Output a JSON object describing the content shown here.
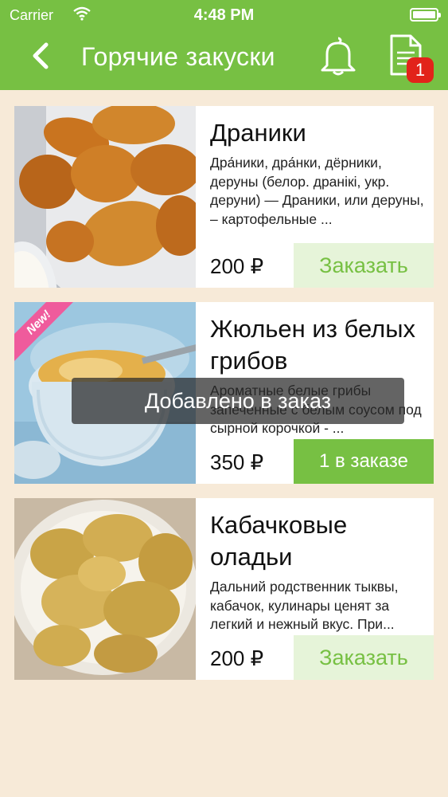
{
  "status_bar": {
    "carrier": "Carrier",
    "time": "4:48 PM"
  },
  "nav": {
    "title": "Горячие закуски",
    "cart_count": "1"
  },
  "items": [
    {
      "title": "Драники",
      "description": "Дра́ники, дра́нки, дёрники, деруны (белор. дранікі, укр. деруни) — Драники, или деруны, – картофельные ...",
      "price": "200 ₽",
      "button": "Заказать"
    },
    {
      "title": "Жюльен из белых грибов",
      "badge": "New!",
      "description": "Ароматные белые грибы запеченные с белым соусом под сырной корочкой - ...",
      "price": "350 ₽",
      "button": "1 в заказе"
    },
    {
      "title": "Кабачковые оладьи",
      "description": "Дальний родственник тыквы, кабачок, кулинары ценят за легкий и нежный вкус. При...",
      "price": "200 ₽",
      "button": "Заказать"
    }
  ],
  "toast": "Добавлено в заказ",
  "colors": {
    "brand_green": "#77c043",
    "badge_red": "#e2231a",
    "new_ribbon": "#ef5b9c",
    "background": "#f7ead8"
  }
}
